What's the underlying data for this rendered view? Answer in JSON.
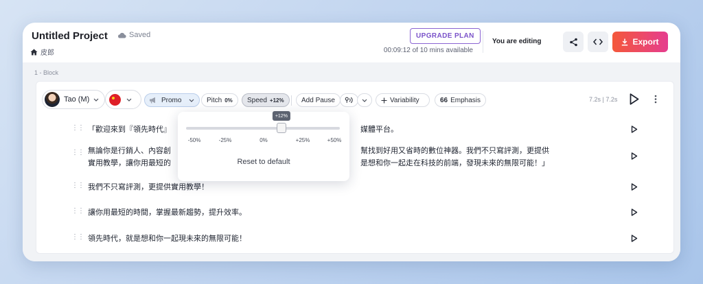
{
  "header": {
    "project_title": "Untitled Project",
    "save_status": "Saved",
    "breadcrumb": "皮郎",
    "upgrade_label": "UPGRADE PLAN",
    "time_available": "00:09:12 of 10 mins available",
    "editing_status": "You are editing",
    "export_label": "Export"
  },
  "block": {
    "label": "1 -  Block",
    "voice_name": "Tao (M)",
    "style_label": "Promo",
    "pitch_label": "Pitch",
    "pitch_value": "0%",
    "speed_label": "Speed",
    "speed_value": "+12%",
    "add_pause_label": "Add Pause",
    "variability_label": "Variability",
    "emphasis_label": "Emphasis",
    "durations": "7.2s | 7.2s"
  },
  "speed_popover": {
    "value": 12,
    "min": -50,
    "max": 50,
    "value_label": "+12%",
    "ticks": [
      "-50%",
      "-25%",
      "0%",
      "+25%",
      "+50%"
    ],
    "reset_label": "Reset to default"
  },
  "rows": [
    {
      "lines": [
        "「歡迎來到『領先時代』",
        "媒體平台。"
      ]
    },
    {
      "lines": [
        "無論你是行銷人、內容創",
        "幫找到好用又省時的數位神器。我們不只寫評測，更提供",
        "實用教學，讓你用最短的",
        "是想和你一起走在科技的前端，發現未來的無限可能！」"
      ]
    },
    {
      "lines": [
        "我們不只寫評測，更提供實用教學！"
      ]
    },
    {
      "lines": [
        "讓你用最短的時間，掌握最新趨勢，提升效率。"
      ]
    },
    {
      "lines": [
        "領先時代，就是想和你一起現未來的無限可能！"
      ]
    }
  ],
  "colors": {
    "accent_purple": "#7a52c9",
    "export_gradient_start": "#f4583a",
    "export_gradient_end": "#e53d8f"
  }
}
